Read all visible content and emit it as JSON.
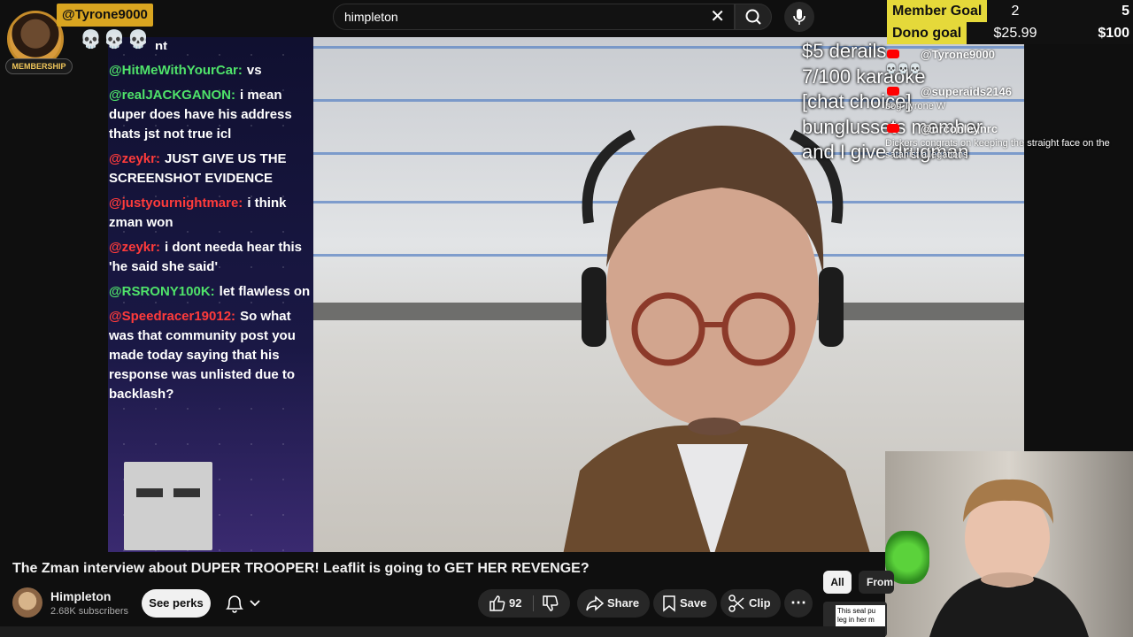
{
  "search": {
    "query": "himpleton"
  },
  "overlay": {
    "membership_label": "MEMBERSHIP",
    "user_tag": "@Tyrone9000",
    "skulls": "💀💀💀",
    "chat_partial": "nt",
    "chat": [
      {
        "user": "@HitMeWithYourCar:",
        "text": "vs",
        "color": "green"
      },
      {
        "user": "@realJACKGANON:",
        "text": "i mean duper does have his address thats jst not true icl",
        "color": "green"
      },
      {
        "user": "@zeykr:",
        "text": "JUST GIVE US THE SCREENSHOT EVIDENCE",
        "color": "red"
      },
      {
        "user": "@justyournightmare:",
        "text": "i think zman won",
        "color": "red"
      },
      {
        "user": "@zeykr:",
        "text": "i dont needa hear this 'he said she said'",
        "color": "red"
      },
      {
        "user": "@RSRONY100K:",
        "text": "let flawless on",
        "color": "green"
      },
      {
        "user": "@Speedracer19012:",
        "text": "So what was that community post you made today saying that his response was unlisted due to backlash?",
        "color": "red"
      }
    ]
  },
  "goals": {
    "member_label": "Member Goal",
    "member_current": "2",
    "member_target": "5",
    "dono_label": "Dono goal",
    "dono_current": "$25.99",
    "dono_target": "$100"
  },
  "donation_overlay": [
    "$5 derails",
    "7/100 karaoke",
    "[chat choice]",
    "bunglussets member",
    "and I give drugman"
  ],
  "stream_chat": [
    {
      "name": "@Tyrone9000",
      "text": "💀💀💀"
    },
    {
      "name": "@superaids2146",
      "text": "bog Tyrone W"
    },
    {
      "name": "@nrconleynrc",
      "text": "Dickers congrats on keeping the straight face on the satanist allegations"
    }
  ],
  "video": {
    "title": "The Zman interview about DUPER TROOPER! Leaflit is going to GET HER REVENGE?",
    "channel": "Himpleton",
    "subscribers": "2.68K subscribers",
    "perks_label": "See perks",
    "likes": "92",
    "share_label": "Share",
    "save_label": "Save",
    "clip_label": "Clip"
  },
  "sidebar": {
    "chip_all": "All",
    "chip_from": "From",
    "thumb_text": "This seal pu leg in her m"
  },
  "colors": {
    "green": "#4fe36a",
    "red": "#ff3b3b",
    "gold": "#e5d93a"
  }
}
